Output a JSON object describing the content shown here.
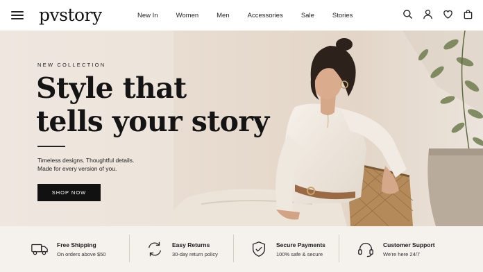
{
  "brand": {
    "logo_text": "pvstory"
  },
  "nav": {
    "items": [
      {
        "label": "New In"
      },
      {
        "label": "Women"
      },
      {
        "label": "Men"
      },
      {
        "label": "Accessories"
      },
      {
        "label": "Sale"
      },
      {
        "label": "Stories"
      }
    ]
  },
  "header_icons": [
    "search-icon",
    "user-icon",
    "heart-icon",
    "bag-icon"
  ],
  "hero": {
    "eyebrow": "NEW COLLECTION",
    "headline_line1": "Style that",
    "headline_line2": "tells your story",
    "subtext_line1": "Timeless designs. Thoughtful details.",
    "subtext_line2": "Made for every version of you.",
    "cta_label": "SHOP NOW"
  },
  "features": [
    {
      "icon": "truck-icon",
      "title": "Free Shipping",
      "desc": "On orders above $50"
    },
    {
      "icon": "returns-icon",
      "title": "Easy Returns",
      "desc": "30-day return policy"
    },
    {
      "icon": "shield-icon",
      "title": "Secure Payments",
      "desc": "100% safe & secure"
    },
    {
      "icon": "headset-icon",
      "title": "Customer Support",
      "desc": "We're here 24/7"
    }
  ],
  "colors": {
    "cta_bg": "#111111",
    "hero_bg": "#ece3da",
    "features_bg": "#f5f1ec"
  }
}
